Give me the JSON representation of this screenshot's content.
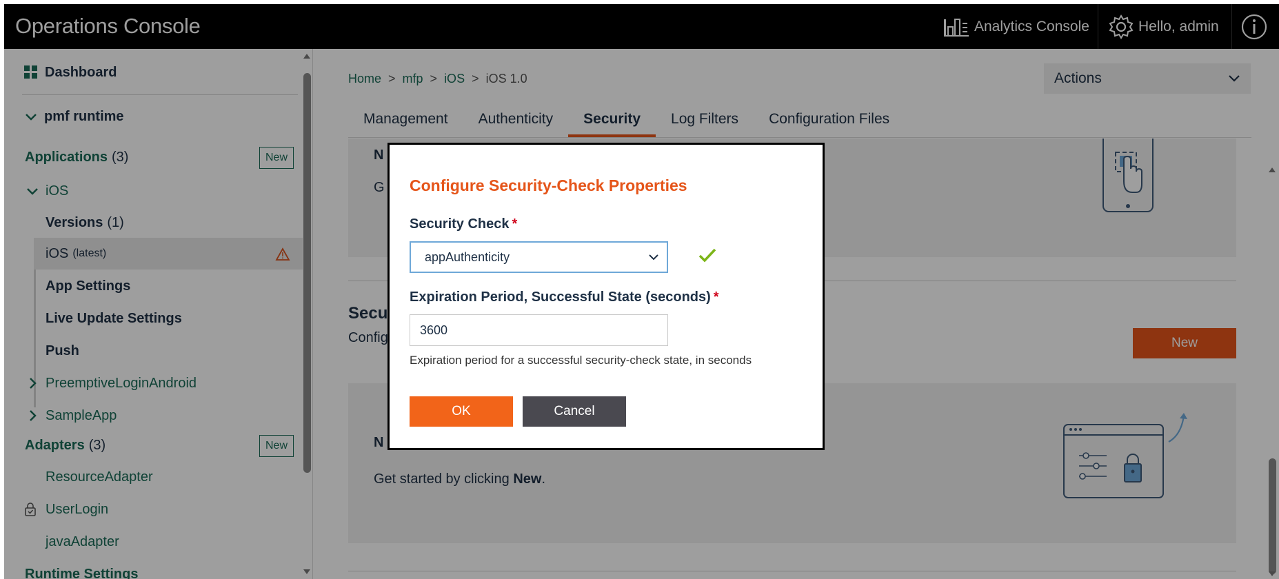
{
  "header": {
    "title": "Operations Console",
    "analytics_label": "Analytics Console",
    "user_label": "Hello, admin",
    "icons": [
      "analytics-icon",
      "gear-icon",
      "info-icon"
    ]
  },
  "sidebar": {
    "dashboard": "Dashboard",
    "runtime": "pmf runtime",
    "applications_label": "Applications",
    "applications_count": "(3)",
    "new_label": "New",
    "ios_app": "iOS",
    "versions_label": "Versions",
    "versions_count": "(1)",
    "ios_latest_name": "iOS",
    "ios_latest_tag": "(latest)",
    "app_settings": "App Settings",
    "live_update": "Live Update Settings",
    "push": "Push",
    "preemptive": "PreemptiveLoginAndroid",
    "sample_app": "SampleApp",
    "adapters_label": "Adapters",
    "adapters_count": "(3)",
    "resource_adapter": "ResourceAdapter",
    "user_login": "UserLogin",
    "java_adapter": "javaAdapter",
    "runtime_settings": "Runtime Settings"
  },
  "main": {
    "breadcrumb": [
      "Home",
      "mfp",
      "iOS",
      "iOS 1.0"
    ],
    "breadcrumb_sep": ">",
    "actions_label": "Actions",
    "tabs": [
      "Management",
      "Authenticity",
      "Security",
      "Log Filters",
      "Configuration Files"
    ],
    "active_tab": "Security",
    "section1_title": "N",
    "section1_sub": "G",
    "section2_title": "Secu",
    "section2_sub": "Config",
    "new_button": "New",
    "panel2_title": "N",
    "panel2_text_prefix": "Get started by clicking ",
    "panel2_text_bold": "New",
    "panel2_text_suffix": "."
  },
  "modal": {
    "title": "Configure Security-Check Properties",
    "security_check_label": "Security Check",
    "required_mark": "*",
    "security_check_value": "appAuthenticity",
    "expiration_label": "Expiration Period, Successful State (seconds)",
    "expiration_value": "3600",
    "expiration_help": "Expiration period for a successful security-check state, in seconds",
    "ok_label": "OK",
    "cancel_label": "Cancel"
  },
  "colors": {
    "accent": "#e5551a",
    "ok_button": "#f26419",
    "cancel_button": "#4a4950",
    "link": "#1a6b57",
    "valid_check": "#7cb518",
    "warning": "#d9531e"
  }
}
